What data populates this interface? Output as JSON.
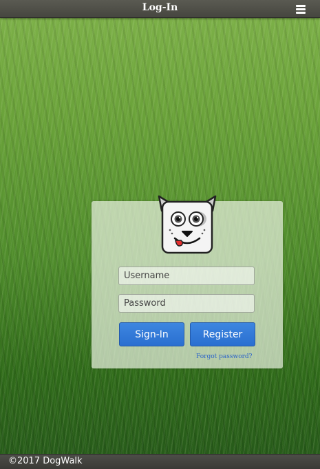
{
  "header": {
    "title": "Log-In",
    "menu_icon": "hamburger-menu-icon"
  },
  "logo": {
    "icon": "dog-face-icon"
  },
  "login": {
    "username_placeholder": "Username",
    "username_value": "",
    "password_placeholder": "Password",
    "password_value": "",
    "signin_label": "Sign-In",
    "register_label": "Register",
    "forgot_label": "Forgot password?"
  },
  "footer": {
    "copyright": "©2017 DogWalk"
  },
  "colors": {
    "button": "#2f76d6",
    "link": "#2a63c8",
    "bar": "#4a4a44"
  }
}
